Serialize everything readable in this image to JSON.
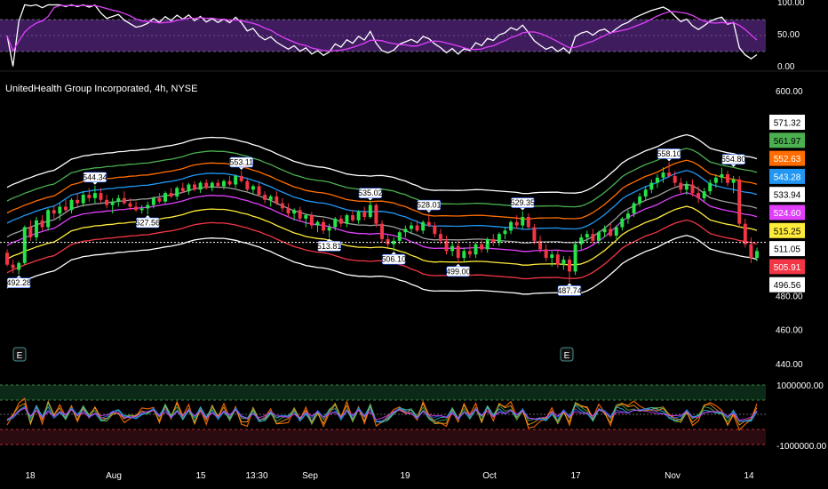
{
  "chart_data": {
    "type": "candlestick",
    "title": "UnitedHealth Group Incorporated, 4h, NYSE",
    "ylim": [
      440,
      600
    ],
    "y_ticks": [
      600,
      480,
      460,
      440
    ],
    "x_ticks": [
      "18",
      "Aug",
      "15",
      "13:30",
      "Sep",
      "19",
      "Oct",
      "17",
      "Nov",
      "14"
    ],
    "band_labels": [
      {
        "value": "571.32",
        "color": "#ffffff"
      },
      {
        "value": "561.97",
        "color": "#4caf50"
      },
      {
        "value": "552.63",
        "color": "#ff6d00"
      },
      {
        "value": "543.28",
        "color": "#2196f3"
      },
      {
        "value": "533.94",
        "color": "#ffffff"
      },
      {
        "value": "524.60",
        "color": "#e040fb"
      },
      {
        "value": "515.25",
        "color": "#ffeb3b"
      },
      {
        "value": "511.05",
        "color": "#ffffff"
      },
      {
        "value": "505.91",
        "color": "#f23645"
      },
      {
        "value": "496.56",
        "color": "#ffffff"
      }
    ],
    "current_price": 511.05,
    "pivot_labels": [
      {
        "label": "492.28",
        "type": "low",
        "i": 2,
        "v": 492.28
      },
      {
        "label": "544.34",
        "type": "high",
        "i": 15,
        "v": 544.34
      },
      {
        "label": "527.56",
        "type": "low",
        "i": 24,
        "v": 527.56
      },
      {
        "label": "553.11",
        "type": "high",
        "i": 40,
        "v": 553.11
      },
      {
        "label": "513.81",
        "type": "low",
        "i": 55,
        "v": 513.81
      },
      {
        "label": "535.02",
        "type": "high",
        "i": 62,
        "v": 535.02
      },
      {
        "label": "506.10",
        "type": "low",
        "i": 66,
        "v": 506.1
      },
      {
        "label": "528.01",
        "type": "high",
        "i": 72,
        "v": 528.01
      },
      {
        "label": "499.00",
        "type": "low",
        "i": 77,
        "v": 499.0
      },
      {
        "label": "529.35",
        "type": "high",
        "i": 88,
        "v": 529.35
      },
      {
        "label": "487.74",
        "type": "low",
        "i": 96,
        "v": 487.74
      },
      {
        "label": "558.10",
        "type": "high",
        "i": 113,
        "v": 558.1
      },
      {
        "label": "554.80",
        "type": "high",
        "i": 124,
        "v": 554.8
      }
    ],
    "candles": [
      {
        "o": 505,
        "h": 507,
        "l": 497,
        "c": 498
      },
      {
        "o": 498,
        "h": 501,
        "l": 493,
        "c": 496
      },
      {
        "o": 495,
        "h": 500,
        "l": 492.28,
        "c": 499
      },
      {
        "o": 499,
        "h": 521,
        "l": 498,
        "c": 520
      },
      {
        "o": 520,
        "h": 524,
        "l": 512,
        "c": 514
      },
      {
        "o": 514,
        "h": 526,
        "l": 512,
        "c": 524
      },
      {
        "o": 524,
        "h": 527,
        "l": 518,
        "c": 520
      },
      {
        "o": 520,
        "h": 531,
        "l": 518,
        "c": 530
      },
      {
        "o": 530,
        "h": 533,
        "l": 525,
        "c": 528
      },
      {
        "o": 528,
        "h": 534,
        "l": 524,
        "c": 532
      },
      {
        "o": 532,
        "h": 536,
        "l": 528,
        "c": 530
      },
      {
        "o": 530,
        "h": 537,
        "l": 528,
        "c": 536
      },
      {
        "o": 536,
        "h": 540,
        "l": 532,
        "c": 534
      },
      {
        "o": 534,
        "h": 541,
        "l": 532,
        "c": 539
      },
      {
        "o": 539,
        "h": 543,
        "l": 535,
        "c": 537
      },
      {
        "o": 537,
        "h": 544.34,
        "l": 534,
        "c": 540
      },
      {
        "o": 540,
        "h": 543,
        "l": 534,
        "c": 536
      },
      {
        "o": 536,
        "h": 539,
        "l": 531,
        "c": 533
      },
      {
        "o": 533,
        "h": 537,
        "l": 528,
        "c": 535
      },
      {
        "o": 535,
        "h": 539,
        "l": 532,
        "c": 537
      },
      {
        "o": 537,
        "h": 541,
        "l": 533,
        "c": 534
      },
      {
        "o": 534,
        "h": 537,
        "l": 530,
        "c": 532
      },
      {
        "o": 532,
        "h": 535,
        "l": 529,
        "c": 530
      },
      {
        "o": 530,
        "h": 533,
        "l": 528,
        "c": 531
      },
      {
        "o": 531,
        "h": 535,
        "l": 527.56,
        "c": 533
      },
      {
        "o": 533,
        "h": 538,
        "l": 531,
        "c": 537
      },
      {
        "o": 537,
        "h": 540,
        "l": 534,
        "c": 535
      },
      {
        "o": 535,
        "h": 541,
        "l": 534,
        "c": 540
      },
      {
        "o": 540,
        "h": 543,
        "l": 537,
        "c": 538
      },
      {
        "o": 538,
        "h": 544,
        "l": 536,
        "c": 543
      },
      {
        "o": 543,
        "h": 546,
        "l": 540,
        "c": 541
      },
      {
        "o": 541,
        "h": 546,
        "l": 539,
        "c": 545
      },
      {
        "o": 545,
        "h": 547,
        "l": 541,
        "c": 542
      },
      {
        "o": 542,
        "h": 547,
        "l": 540,
        "c": 546
      },
      {
        "o": 546,
        "h": 548,
        "l": 542,
        "c": 543
      },
      {
        "o": 543,
        "h": 547,
        "l": 541,
        "c": 546
      },
      {
        "o": 546,
        "h": 548,
        "l": 543,
        "c": 544
      },
      {
        "o": 544,
        "h": 548,
        "l": 542,
        "c": 547
      },
      {
        "o": 547,
        "h": 550,
        "l": 544,
        "c": 545
      },
      {
        "o": 545,
        "h": 551,
        "l": 543,
        "c": 550
      },
      {
        "o": 550,
        "h": 553.11,
        "l": 546,
        "c": 547
      },
      {
        "o": 547,
        "h": 549,
        "l": 541,
        "c": 542
      },
      {
        "o": 542,
        "h": 545,
        "l": 539,
        "c": 544
      },
      {
        "o": 544,
        "h": 546,
        "l": 538,
        "c": 539
      },
      {
        "o": 539,
        "h": 541,
        "l": 534,
        "c": 536
      },
      {
        "o": 536,
        "h": 539,
        "l": 532,
        "c": 538
      },
      {
        "o": 538,
        "h": 541,
        "l": 533,
        "c": 534
      },
      {
        "o": 534,
        "h": 537,
        "l": 529,
        "c": 531
      },
      {
        "o": 531,
        "h": 534,
        "l": 526,
        "c": 528
      },
      {
        "o": 528,
        "h": 531,
        "l": 524,
        "c": 530
      },
      {
        "o": 530,
        "h": 532,
        "l": 523,
        "c": 525
      },
      {
        "o": 525,
        "h": 528,
        "l": 520,
        "c": 527
      },
      {
        "o": 527,
        "h": 529,
        "l": 519,
        "c": 521
      },
      {
        "o": 521,
        "h": 524,
        "l": 517,
        "c": 523
      },
      {
        "o": 523,
        "h": 525,
        "l": 516,
        "c": 518
      },
      {
        "o": 518,
        "h": 522,
        "l": 513.81,
        "c": 520
      },
      {
        "o": 520,
        "h": 526,
        "l": 518,
        "c": 525
      },
      {
        "o": 525,
        "h": 527,
        "l": 520,
        "c": 522
      },
      {
        "o": 522,
        "h": 528,
        "l": 520,
        "c": 527
      },
      {
        "o": 527,
        "h": 530,
        "l": 523,
        "c": 524
      },
      {
        "o": 524,
        "h": 530,
        "l": 522,
        "c": 529
      },
      {
        "o": 529,
        "h": 532,
        "l": 524,
        "c": 526
      },
      {
        "o": 526,
        "h": 535.02,
        "l": 525,
        "c": 533
      },
      {
        "o": 533,
        "h": 534,
        "l": 520,
        "c": 522
      },
      {
        "o": 522,
        "h": 524,
        "l": 511,
        "c": 513
      },
      {
        "o": 513,
        "h": 516,
        "l": 508,
        "c": 510
      },
      {
        "o": 510,
        "h": 514,
        "l": 506.1,
        "c": 512
      },
      {
        "o": 512,
        "h": 518,
        "l": 510,
        "c": 517
      },
      {
        "o": 517,
        "h": 521,
        "l": 514,
        "c": 519
      },
      {
        "o": 519,
        "h": 523,
        "l": 516,
        "c": 521
      },
      {
        "o": 521,
        "h": 524,
        "l": 517,
        "c": 518
      },
      {
        "o": 518,
        "h": 524,
        "l": 516,
        "c": 523
      },
      {
        "o": 523,
        "h": 528.01,
        "l": 520,
        "c": 521
      },
      {
        "o": 521,
        "h": 523,
        "l": 514,
        "c": 516
      },
      {
        "o": 516,
        "h": 519,
        "l": 510,
        "c": 512
      },
      {
        "o": 512,
        "h": 515,
        "l": 504,
        "c": 506
      },
      {
        "o": 506,
        "h": 511,
        "l": 503,
        "c": 509
      },
      {
        "o": 509,
        "h": 512,
        "l": 499,
        "c": 502
      },
      {
        "o": 502,
        "h": 508,
        "l": 500,
        "c": 506
      },
      {
        "o": 506,
        "h": 510,
        "l": 502,
        "c": 504
      },
      {
        "o": 504,
        "h": 511,
        "l": 502,
        "c": 510
      },
      {
        "o": 510,
        "h": 513,
        "l": 505,
        "c": 507
      },
      {
        "o": 507,
        "h": 514,
        "l": 505,
        "c": 513
      },
      {
        "o": 513,
        "h": 516,
        "l": 509,
        "c": 511
      },
      {
        "o": 511,
        "h": 517,
        "l": 509,
        "c": 516
      },
      {
        "o": 516,
        "h": 520,
        "l": 513,
        "c": 518
      },
      {
        "o": 518,
        "h": 524,
        "l": 516,
        "c": 523
      },
      {
        "o": 523,
        "h": 527,
        "l": 519,
        "c": 521
      },
      {
        "o": 521,
        "h": 529.35,
        "l": 519,
        "c": 526
      },
      {
        "o": 526,
        "h": 528,
        "l": 519,
        "c": 520
      },
      {
        "o": 520,
        "h": 522,
        "l": 510,
        "c": 512
      },
      {
        "o": 512,
        "h": 515,
        "l": 505,
        "c": 507
      },
      {
        "o": 507,
        "h": 510,
        "l": 500,
        "c": 502
      },
      {
        "o": 502,
        "h": 506,
        "l": 497,
        "c": 504
      },
      {
        "o": 504,
        "h": 507,
        "l": 496,
        "c": 498
      },
      {
        "o": 498,
        "h": 503,
        "l": 495,
        "c": 501
      },
      {
        "o": 501,
        "h": 503,
        "l": 487.74,
        "c": 494
      },
      {
        "o": 494,
        "h": 512,
        "l": 492,
        "c": 510
      },
      {
        "o": 510,
        "h": 516,
        "l": 507,
        "c": 514
      },
      {
        "o": 514,
        "h": 518,
        "l": 511,
        "c": 516
      },
      {
        "o": 516,
        "h": 519,
        "l": 510,
        "c": 512
      },
      {
        "o": 512,
        "h": 518,
        "l": 510,
        "c": 517
      },
      {
        "o": 517,
        "h": 521,
        "l": 514,
        "c": 519
      },
      {
        "o": 519,
        "h": 522,
        "l": 514,
        "c": 515
      },
      {
        "o": 515,
        "h": 521,
        "l": 513,
        "c": 520
      },
      {
        "o": 520,
        "h": 526,
        "l": 518,
        "c": 525
      },
      {
        "o": 525,
        "h": 530,
        "l": 522,
        "c": 528
      },
      {
        "o": 528,
        "h": 535,
        "l": 526,
        "c": 534
      },
      {
        "o": 534,
        "h": 540,
        "l": 532,
        "c": 538
      },
      {
        "o": 538,
        "h": 544,
        "l": 536,
        "c": 542
      },
      {
        "o": 542,
        "h": 548,
        "l": 540,
        "c": 546
      },
      {
        "o": 546,
        "h": 551,
        "l": 543,
        "c": 549
      },
      {
        "o": 549,
        "h": 555,
        "l": 546,
        "c": 552
      },
      {
        "o": 552,
        "h": 558.1,
        "l": 549,
        "c": 550
      },
      {
        "o": 550,
        "h": 553,
        "l": 544,
        "c": 546
      },
      {
        "o": 546,
        "h": 549,
        "l": 540,
        "c": 542
      },
      {
        "o": 542,
        "h": 547,
        "l": 539,
        "c": 545
      },
      {
        "o": 545,
        "h": 548,
        "l": 538,
        "c": 540
      },
      {
        "o": 540,
        "h": 544,
        "l": 534,
        "c": 537
      },
      {
        "o": 537,
        "h": 543,
        "l": 535,
        "c": 541
      },
      {
        "o": 541,
        "h": 548,
        "l": 539,
        "c": 546
      },
      {
        "o": 546,
        "h": 551,
        "l": 543,
        "c": 549
      },
      {
        "o": 549,
        "h": 554.8,
        "l": 546,
        "c": 551
      },
      {
        "o": 551,
        "h": 553,
        "l": 544,
        "c": 546
      },
      {
        "o": 546,
        "h": 550,
        "l": 540,
        "c": 548
      },
      {
        "o": 548,
        "h": 550,
        "l": 520,
        "c": 522
      },
      {
        "o": 522,
        "h": 525,
        "l": 508,
        "c": 510
      },
      {
        "o": 510,
        "h": 514,
        "l": 499,
        "c": 502
      },
      {
        "o": 502,
        "h": 508,
        "l": 500,
        "c": 506
      }
    ],
    "rsi_panel": {
      "ylim": [
        0,
        100
      ],
      "y_ticks": [
        "100.00",
        "50.00",
        "0.00"
      ]
    },
    "osc_panel": {
      "y_ticks": [
        "1000000.00",
        "-1000000.00"
      ],
      "earnings_markers": [
        "E",
        "E"
      ]
    }
  }
}
